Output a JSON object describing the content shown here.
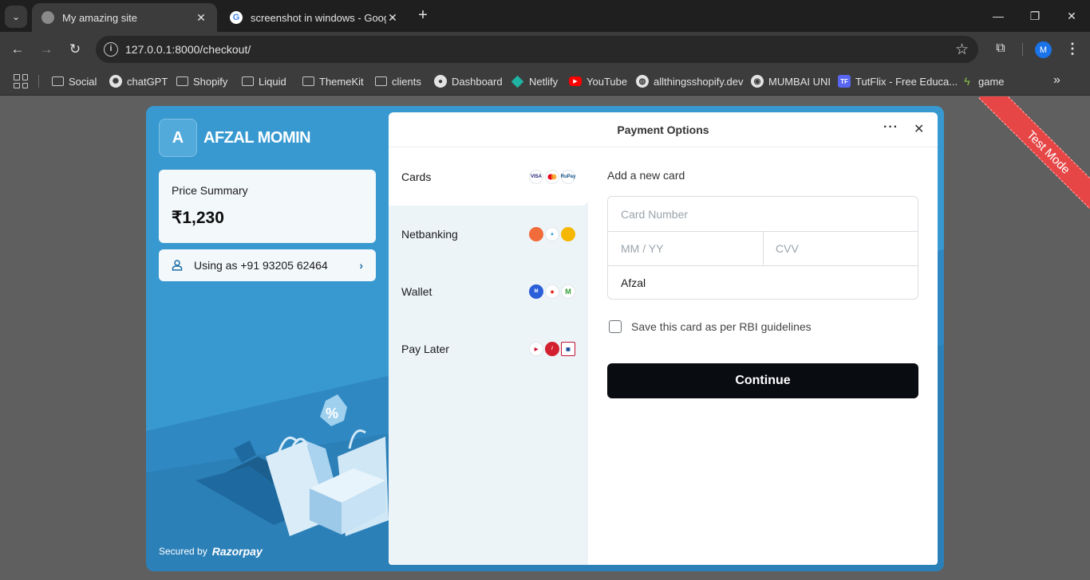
{
  "browser": {
    "tabs": [
      {
        "title": "My amazing site",
        "active": true
      },
      {
        "title": "screenshot in windows - Google",
        "active": false
      }
    ],
    "url": "127.0.0.1:8000/checkout/",
    "profile_initial": "M",
    "bookmarks": [
      {
        "label": "Social",
        "icon": "folder-icon"
      },
      {
        "label": "chatGPT",
        "icon": "chatgpt-icon"
      },
      {
        "label": "Shopify",
        "icon": "folder-icon"
      },
      {
        "label": "Liquid",
        "icon": "folder-icon"
      },
      {
        "label": "ThemeKit",
        "icon": "folder-icon"
      },
      {
        "label": "clients",
        "icon": "folder-icon"
      },
      {
        "label": "Dashboard",
        "icon": "github-icon"
      },
      {
        "label": "Netlify",
        "icon": "netlify-icon"
      },
      {
        "label": "YouTube",
        "icon": "youtube-icon"
      },
      {
        "label": "allthingsshopify.dev",
        "icon": "globe-icon"
      },
      {
        "label": "MUMBAI UNI",
        "icon": "university-icon"
      },
      {
        "label": "TutFlix - Free Educa...",
        "icon": "tutflix-icon"
      },
      {
        "label": "game",
        "icon": "game-icon"
      }
    ]
  },
  "checkout": {
    "merchant": {
      "initial": "A",
      "name": "AFZAL MOMIN"
    },
    "price_summary": {
      "label": "Price Summary",
      "amount": "₹1,230"
    },
    "user": {
      "text": "Using as +91 93205 62464"
    },
    "secured_by": {
      "label": "Secured by",
      "brand": "Razorpay"
    },
    "panel_title": "Payment Options",
    "methods": [
      {
        "label": "Cards",
        "icons": [
          "visa-icon",
          "mastercard-icon",
          "rupay-icon"
        ],
        "selected": true
      },
      {
        "label": "Netbanking",
        "icons": [
          "bank-icon",
          "bank-icon",
          "bank-icon"
        ],
        "selected": false
      },
      {
        "label": "Wallet",
        "icons": [
          "wallet-icon",
          "wallet-icon",
          "wallet-icon"
        ],
        "selected": false
      },
      {
        "label": "Pay Later",
        "icons": [
          "paylater-icon",
          "paylater-icon",
          "paylater-icon"
        ],
        "selected": false
      }
    ],
    "card_form": {
      "heading": "Add a new card",
      "card_number_placeholder": "Card Number",
      "expiry_placeholder": "MM / YY",
      "cvv_placeholder": "CVV",
      "name_value": "Afzal",
      "save_label": "Save this card as per RBI guidelines",
      "save_checked": false,
      "continue_label": "Continue"
    },
    "ribbon": "Test Mode"
  },
  "colors": {
    "accent": "#3899d0",
    "panel_sidebar": "#edf4f8",
    "button": "#090c10",
    "ribbon": "#e64646"
  }
}
